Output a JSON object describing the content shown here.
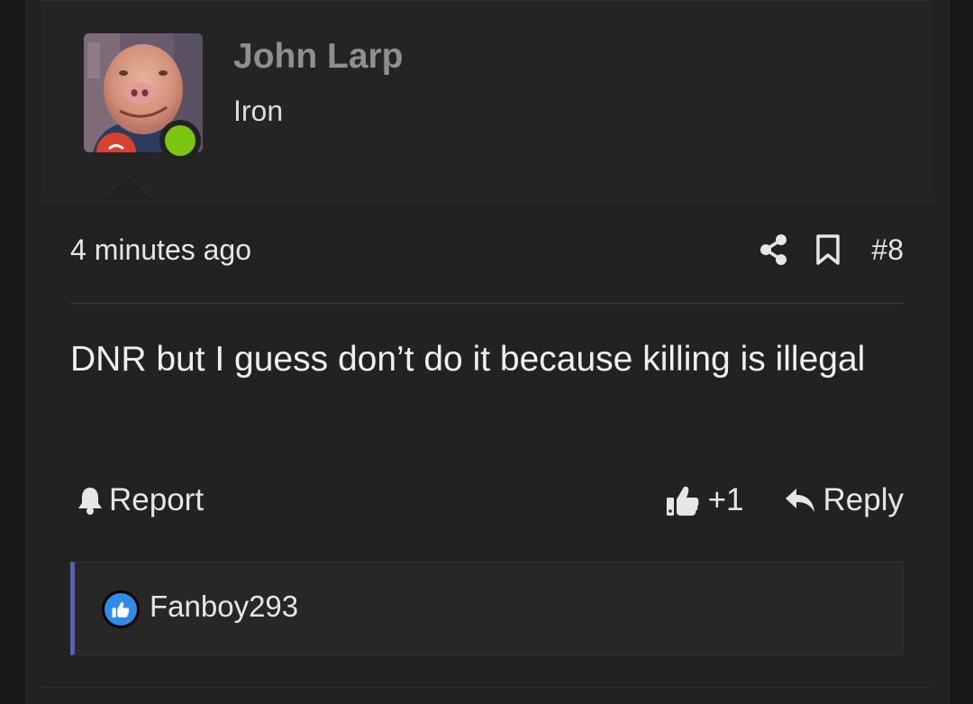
{
  "author": {
    "username": "John Larp",
    "user_title": "Iron",
    "online_status_color": "#7cc511",
    "avatar_icon": "avatar-image"
  },
  "post": {
    "timestamp": "4 minutes ago",
    "post_number": "#8",
    "message": "DNR but I guess don’t do it because killing is illegal",
    "share_icon": "share-icon",
    "bookmark_icon": "bookmark-icon"
  },
  "actions": {
    "report_label": "Report",
    "like_count": "+1",
    "reply_label": "Reply"
  },
  "reactions": {
    "reaction_icon": "like-reaction-icon",
    "users": [
      "Fanboy293"
    ]
  },
  "colors": {
    "background": "#222222",
    "header_background": "#242424",
    "username_color": "#8f8f8f",
    "text_color": "#e6e6e6",
    "reaction_accent": "#5a5fb8",
    "like_reaction_blue": "#2e8ce6"
  }
}
